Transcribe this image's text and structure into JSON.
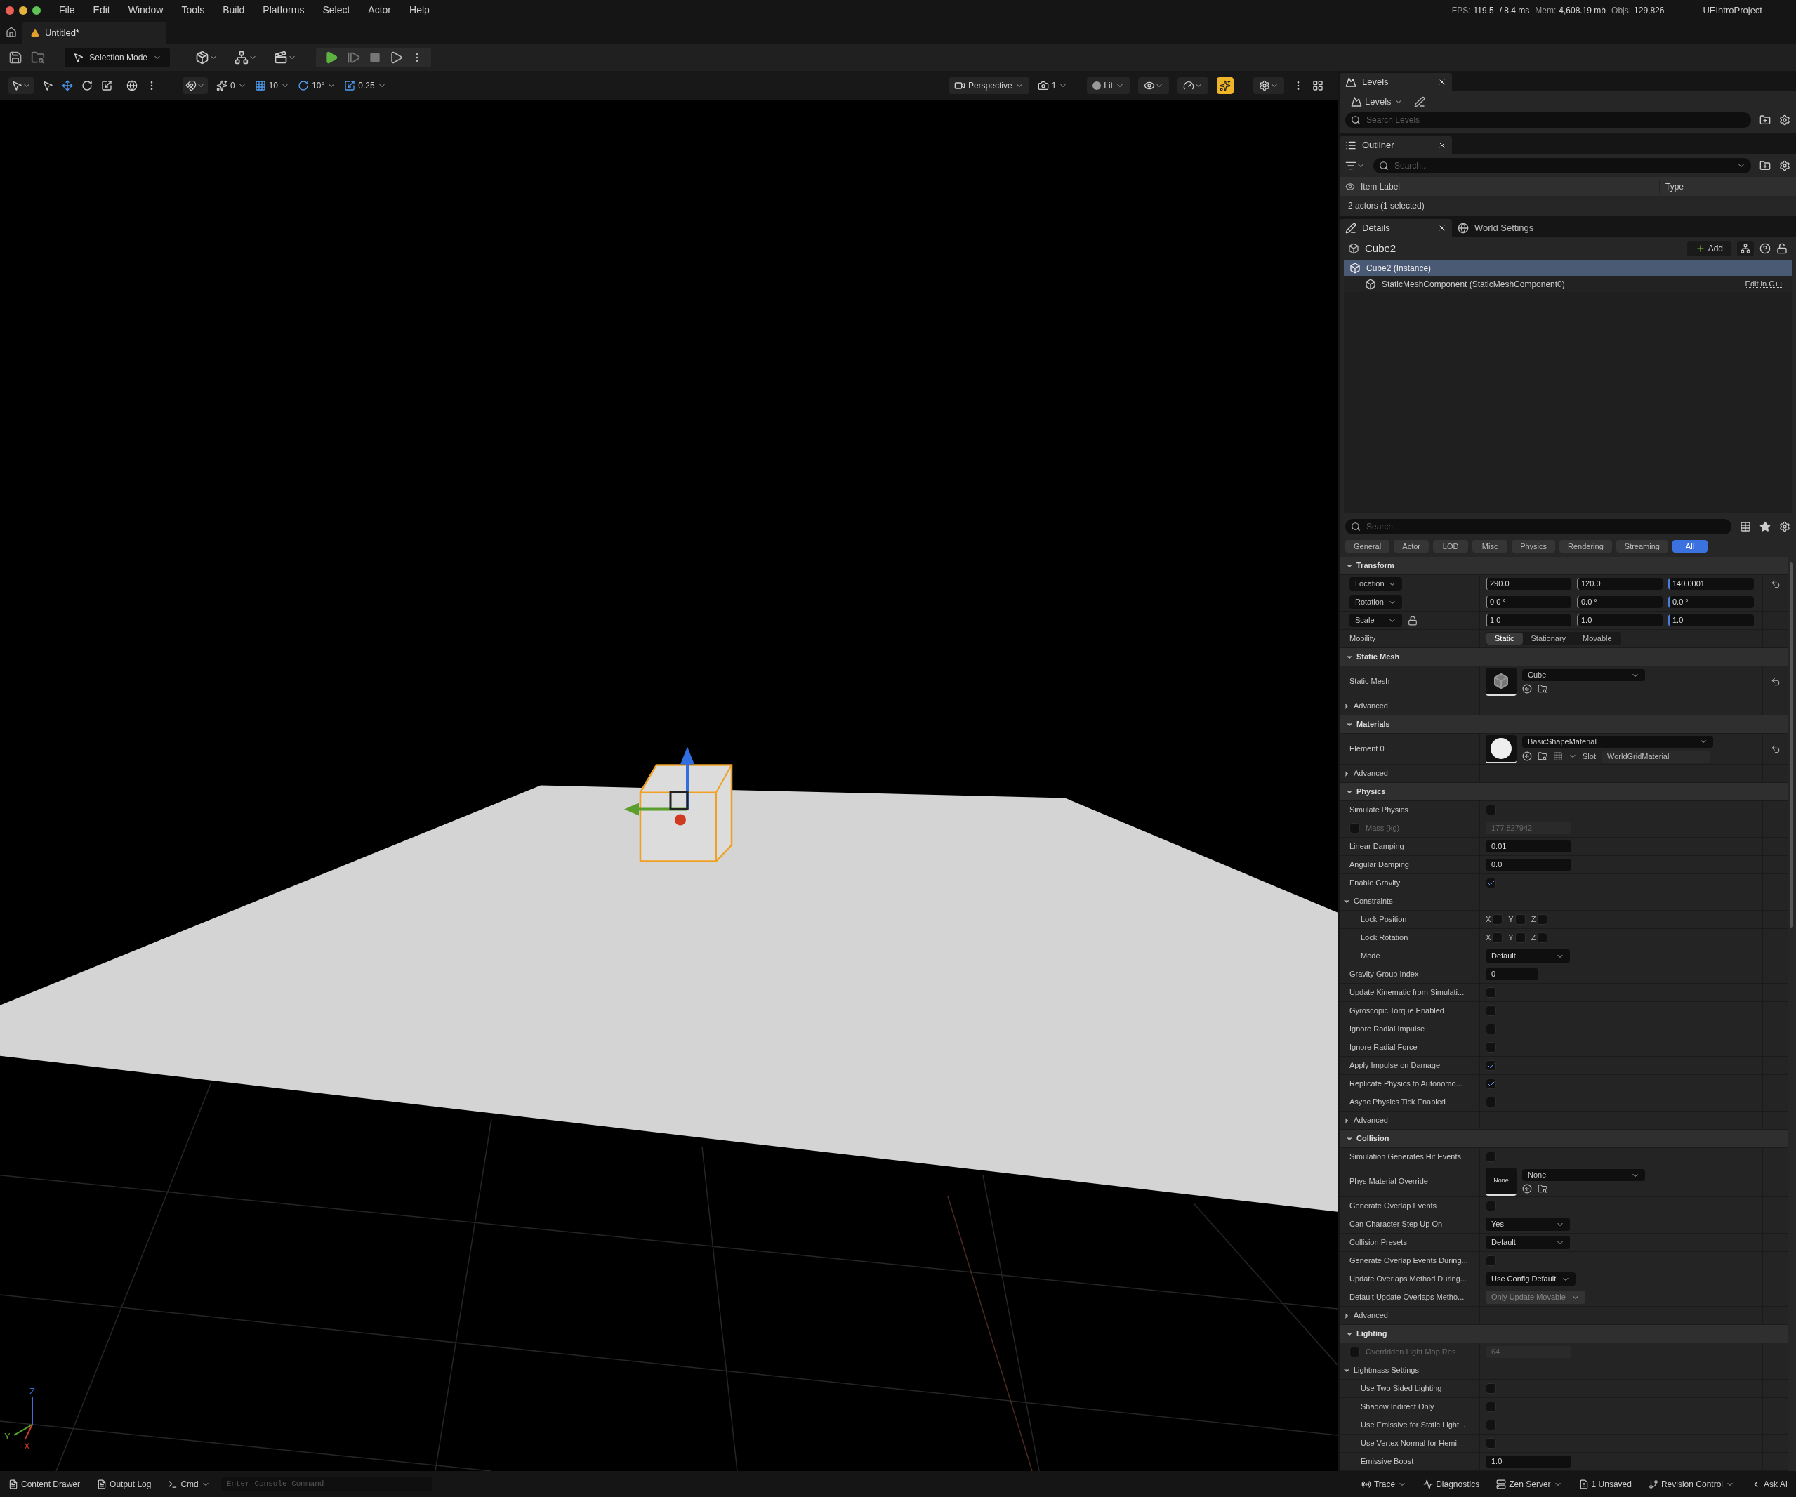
{
  "menu": [
    "File",
    "Edit",
    "Window",
    "Tools",
    "Build",
    "Platforms",
    "Select",
    "Actor",
    "Help"
  ],
  "stats": [
    {
      "label": "FPS:",
      "value": "119.5"
    },
    {
      "value": "/ 8.4 ms"
    },
    {
      "label": "Mem:",
      "value": "4,608.19 mb"
    },
    {
      "label": "Objs:",
      "value": "129,826"
    }
  ],
  "project": "UEIntroProject",
  "document_tab": "Untitled*",
  "toolbar": {
    "mode": "Selection Mode"
  },
  "viewport_toolbar": {
    "surface_snap": "0",
    "grid_snap": "10",
    "rotation_snap": "10°",
    "scale_snap": "0.25",
    "view": "Perspective",
    "camera_speed": "1",
    "view_mode": "Lit",
    "realtime_on": true
  },
  "viewport": {
    "axis_labels": [
      "Z",
      "Y",
      "X"
    ]
  },
  "levels": {
    "tab": "Levels",
    "dropdown": "Levels",
    "search_placeholder": "Search Levels"
  },
  "outliner": {
    "tab": "Outliner",
    "search_placeholder": "Search...",
    "columns": [
      "Item Label",
      "Type"
    ],
    "footer": "2 actors (1 selected)"
  },
  "details": {
    "tabs": [
      {
        "label": "Details",
        "selected": true
      },
      {
        "label": "World Settings",
        "selected": false
      }
    ],
    "actor": "Cube2",
    "add_button": "Add",
    "components": [
      {
        "label": "Cube2 (Instance)",
        "selected": true,
        "children": [
          {
            "label": "StaticMeshComponent (StaticMeshComponent0)",
            "selected": false,
            "link": "Edit in C++"
          }
        ]
      }
    ],
    "search_placeholder": "Search",
    "filters": [
      {
        "label": "General",
        "selected": false
      },
      {
        "label": "Actor",
        "selected": false
      },
      {
        "label": "LOD",
        "selected": false
      },
      {
        "label": "Misc",
        "selected": false
      },
      {
        "label": "Physics",
        "selected": false
      },
      {
        "label": "Rendering",
        "selected": false
      },
      {
        "label": "Streaming",
        "selected": false
      },
      {
        "label": "All",
        "selected": true
      }
    ],
    "sections": [
      {
        "title": "Transform",
        "expanded": true,
        "rows": [
          {
            "kind": "vector",
            "label": "Location",
            "values": [
              "290.0",
              "120.0",
              "140.0001"
            ],
            "reset": true
          },
          {
            "kind": "vector",
            "label": "Rotation",
            "values": [
              "0.0 °",
              "0.0 °",
              "0.0 °"
            ]
          },
          {
            "kind": "vector",
            "label": "Scale",
            "values": [
              "1.0",
              "1.0",
              "1.0"
            ],
            "lock_icon": true
          },
          {
            "kind": "segmented",
            "label": "Mobility",
            "options": [
              {
                "label": "Static",
                "selected": true
              },
              {
                "label": "Stationary",
                "selected": false
              },
              {
                "label": "Movable",
                "selected": false
              }
            ]
          }
        ]
      },
      {
        "title": "Static Mesh",
        "expanded": true,
        "rows": [
          {
            "kind": "asset",
            "label": "Static Mesh",
            "thumbnail": {
              "kind": "cube"
            },
            "value": "Cube",
            "reset": true
          },
          {
            "kind": "group",
            "label": "Advanced",
            "expanded": false
          }
        ]
      },
      {
        "title": "Materials",
        "expanded": true,
        "rows": [
          {
            "kind": "asset",
            "label": "Element 0",
            "thumbnail": {
              "kind": "sphere"
            },
            "value": "BasicShapeMaterial",
            "slot_label": "Slot",
            "slot_value": "WorldGridMaterial",
            "reset": true
          },
          {
            "kind": "group",
            "label": "Advanced",
            "expanded": false
          }
        ]
      },
      {
        "title": "Physics",
        "expanded": true,
        "rows": [
          {
            "kind": "checkbox",
            "label": "Simulate Physics",
            "checked": false
          },
          {
            "kind": "optional_number",
            "label": "Mass (kg)",
            "checked": false,
            "value": "177.827942"
          },
          {
            "kind": "number",
            "label": "Linear Damping",
            "value": "0.01"
          },
          {
            "kind": "number",
            "label": "Angular Damping",
            "value": "0.0"
          },
          {
            "kind": "checkbox",
            "label": "Enable Gravity",
            "checked": true
          },
          {
            "kind": "group",
            "label": "Constraints",
            "expanded": true,
            "children": [
              {
                "kind": "axis_locks",
                "label": "Lock Position",
                "axes": [
                  {
                    "label": "X",
                    "checked": false
                  },
                  {
                    "label": "Y",
                    "checked": false
                  },
                  {
                    "label": "Z",
                    "checked": false
                  }
                ]
              },
              {
                "kind": "axis_locks",
                "label": "Lock Rotation",
                "axes": [
                  {
                    "label": "X",
                    "checked": false
                  },
                  {
                    "label": "Y",
                    "checked": false
                  },
                  {
                    "label": "Z",
                    "checked": false
                  }
                ]
              },
              {
                "kind": "dropdown",
                "label": "Mode",
                "value": "Default",
                "disabled": false
              }
            ]
          },
          {
            "kind": "number",
            "label": "Gravity Group Index",
            "value": "0",
            "short": true
          },
          {
            "kind": "checkbox",
            "label": "Update Kinematic from Simulati...",
            "checked": false
          },
          {
            "kind": "checkbox",
            "label": "Gyroscopic Torque Enabled",
            "checked": false
          },
          {
            "kind": "checkbox",
            "label": "Ignore Radial Impulse",
            "checked": false
          },
          {
            "kind": "checkbox",
            "label": "Ignore Radial Force",
            "checked": false
          },
          {
            "kind": "checkbox",
            "label": "Apply Impulse on Damage",
            "checked": true
          },
          {
            "kind": "checkbox",
            "label": "Replicate Physics to Autonomo...",
            "checked": true
          },
          {
            "kind": "checkbox",
            "label": "Async Physics Tick Enabled",
            "checked": false
          },
          {
            "kind": "group",
            "label": "Advanced",
            "expanded": false
          }
        ]
      },
      {
        "title": "Collision",
        "expanded": true,
        "rows": [
          {
            "kind": "checkbox",
            "label": "Simulation Generates Hit Events",
            "checked": false
          },
          {
            "kind": "asset",
            "label": "Phys Material Override",
            "thumbnail": {
              "kind": "empty",
              "label": "None"
            },
            "value": "None"
          },
          {
            "kind": "checkbox",
            "label": "Generate Overlap Events",
            "checked": false
          },
          {
            "kind": "dropdown",
            "label": "Can Character Step Up On",
            "value": "Yes",
            "disabled": false
          },
          {
            "kind": "dropdown",
            "label": "Collision Presets",
            "value": "Default",
            "disabled": false
          },
          {
            "kind": "checkbox",
            "label": "Generate Overlap Events During...",
            "checked": false
          },
          {
            "kind": "dropdown",
            "label": "Update Overlaps Method During...",
            "value": "Use Config Default",
            "disabled": false
          },
          {
            "kind": "dropdown",
            "label": "Default Update Overlaps Metho...",
            "value": "Only Update Movable",
            "disabled": true
          },
          {
            "kind": "group",
            "label": "Advanced",
            "expanded": false
          }
        ]
      },
      {
        "title": "Lighting",
        "expanded": true,
        "rows": [
          {
            "kind": "optional_number",
            "label": "Overridden Light Map Res",
            "checked": false,
            "value": "64"
          },
          {
            "kind": "group",
            "label": "Lightmass Settings",
            "expanded": true,
            "children": [
              {
                "kind": "checkbox",
                "label": "Use Two Sided Lighting",
                "checked": false
              },
              {
                "kind": "checkbox",
                "label": "Shadow Indirect Only",
                "checked": false
              },
              {
                "kind": "checkbox",
                "label": "Use Emissive for Static Light...",
                "checked": false
              },
              {
                "kind": "checkbox",
                "label": "Use Vertex Normal for Hemi...",
                "checked": false
              },
              {
                "kind": "number",
                "label": "Emissive Boost",
                "value": "1.0"
              }
            ]
          }
        ]
      }
    ]
  },
  "status_bar": {
    "left": [
      {
        "kind": "drawer",
        "label": "Content Drawer"
      },
      {
        "kind": "log",
        "label": "Output Log"
      },
      {
        "kind": "cmd",
        "label": "Cmd"
      }
    ],
    "console_placeholder": "Enter Console Command",
    "right": [
      {
        "kind": "trace",
        "label": "Trace"
      },
      {
        "kind": "diagnostics",
        "label": "Diagnostics"
      },
      {
        "kind": "server",
        "label": "Zen Server"
      },
      {
        "kind": "unsaved",
        "label": "1 Unsaved"
      },
      {
        "kind": "revision",
        "label": "Revision Control"
      },
      {
        "kind": "ai",
        "label": "Ask AI"
      }
    ]
  }
}
